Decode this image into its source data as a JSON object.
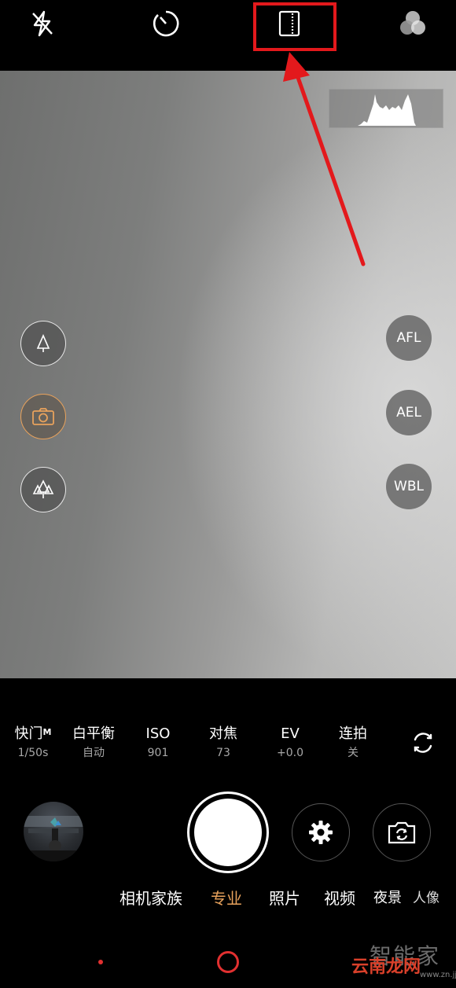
{
  "top_bar": {
    "icons": [
      "flash-off-icon",
      "timer-icon",
      "aspect-ratio-icon",
      "filter-icon"
    ]
  },
  "side_left": [
    "tree-icon",
    "camera-icon",
    "forest-icon"
  ],
  "side_right": {
    "afl": "AFL",
    "ael": "AEL",
    "wbl": "WBL"
  },
  "settings": {
    "shutter": {
      "label": "快门",
      "sup": "M",
      "value": "1/50s"
    },
    "white_balance": {
      "label": "白平衡",
      "value": "自动"
    },
    "iso": {
      "label": "ISO",
      "value": "901"
    },
    "focus": {
      "label": "对焦",
      "value": "73"
    },
    "ev": {
      "label": "EV",
      "value": "+0.0"
    },
    "burst": {
      "label": "连拍",
      "value": "关"
    }
  },
  "modes": {
    "family": "相机家族",
    "pro": "专业",
    "photo": "照片",
    "video": "视频",
    "night": "夜景",
    "portrait": "人像"
  },
  "watermark": {
    "line1": "智能家",
    "line2": "云南龙网",
    "line3": "www.zn.jj.com"
  },
  "colors": {
    "accent": "#e8a25c",
    "annotation": "#e3191c"
  }
}
